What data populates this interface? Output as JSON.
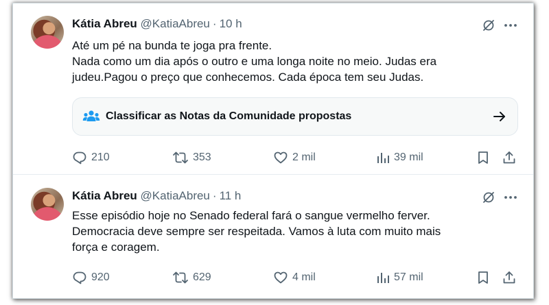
{
  "tweets": [
    {
      "author": {
        "name": "Kátia Abreu",
        "handle": "@KatiaAbreu"
      },
      "separator": "·",
      "time": "10 h",
      "lines": [
        "Até um pé na bunda te joga pra frente.",
        "Nada como um dia após o outro e uma longa noite no meio. Judas era",
        "judeu.Pagou o preço que conhecemos. Cada época tem seu Judas."
      ],
      "community_notes": {
        "label": "Classificar as Notas da Comunidade propostas"
      },
      "stats": {
        "replies": "210",
        "retweets": "353",
        "likes": "2 mil",
        "views": "39 mil"
      },
      "icons": [
        "grok-icon",
        "more-icon",
        "people-icon",
        "arrow-right-icon",
        "reply-icon",
        "retweet-icon",
        "like-icon",
        "views-icon",
        "bookmark-icon",
        "share-icon"
      ]
    },
    {
      "author": {
        "name": "Kátia Abreu",
        "handle": "@KatiaAbreu"
      },
      "separator": "·",
      "time": "11 h",
      "lines": [
        "Esse episódio hoje no Senado federal fará o sangue vermelho ferver.",
        "Democracia deve sempre ser respeitada. Vamos à luta com muito mais",
        "força e coragem."
      ],
      "stats": {
        "replies": "920",
        "retweets": "629",
        "likes": "4 mil",
        "views": "57 mil"
      },
      "icons": [
        "grok-icon",
        "more-icon",
        "reply-icon",
        "retweet-icon",
        "like-icon",
        "views-icon",
        "bookmark-icon",
        "share-icon"
      ]
    }
  ],
  "colors": {
    "text": "#0f1419",
    "secondary": "#536471",
    "notes_icon": "#1d9bf0",
    "border": "#e6ecf0"
  }
}
